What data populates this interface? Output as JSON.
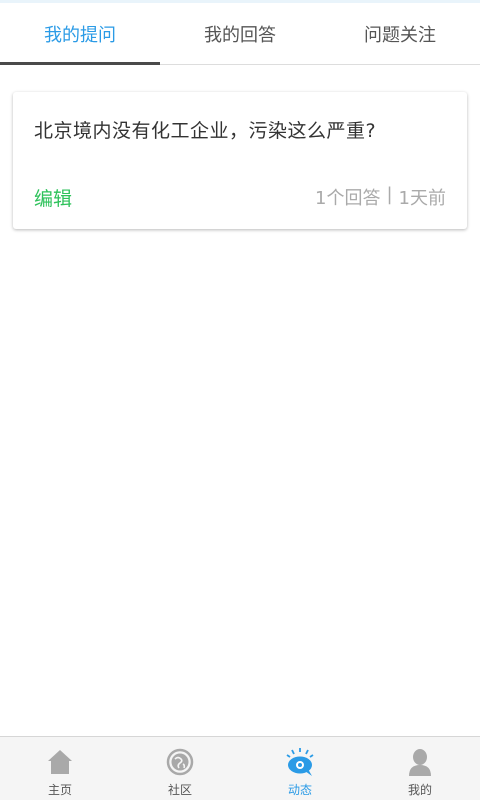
{
  "tabs": [
    {
      "label": "我的提问",
      "active": true
    },
    {
      "label": "我的回答",
      "active": false
    },
    {
      "label": "问题关注",
      "active": false
    }
  ],
  "question_card": {
    "title": "北京境内没有化工企业，污染这么严重?",
    "edit_label": "编辑",
    "answer_count": "1个回答",
    "separator": "|",
    "time_ago": "1天前"
  },
  "bottom_nav": [
    {
      "label": "主页",
      "icon": "home-icon",
      "active": false
    },
    {
      "label": "社区",
      "icon": "community-icon",
      "active": false
    },
    {
      "label": "动态",
      "icon": "activity-icon",
      "active": true
    },
    {
      "label": "我的",
      "icon": "profile-icon",
      "active": false
    }
  ],
  "colors": {
    "accent": "#2b9be6",
    "edit_green": "#2ec25b",
    "meta_gray": "#aaaaaa",
    "nav_icon_gray": "#a9a9a9"
  }
}
